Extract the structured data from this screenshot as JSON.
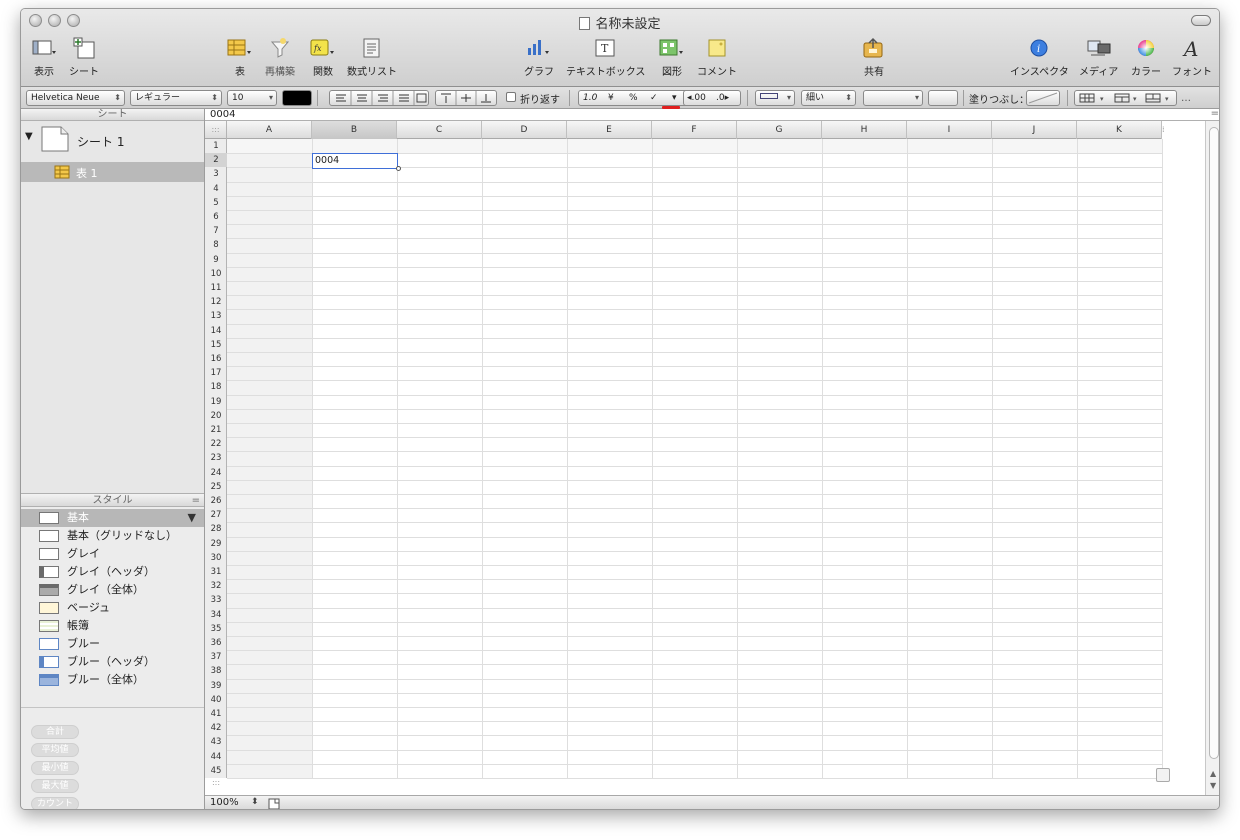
{
  "window": {
    "title": "名称未設定"
  },
  "toolbar": {
    "view": "表示",
    "sheet": "シート",
    "table": "表",
    "reorganize": "再構築",
    "function": "関数",
    "formula_list": "数式リスト",
    "chart": "グラフ",
    "textbox": "テキストボックス",
    "shape": "図形",
    "comment": "コメント",
    "share": "共有",
    "inspector": "インスペクタ",
    "media": "メディア",
    "colors": "カラー",
    "fonts": "フォント"
  },
  "formatbar": {
    "font_family": "Helvetica Neue",
    "font_style": "レギュラー",
    "font_size": "10",
    "wrap": "折り返す",
    "currency": "¥",
    "percent": "%",
    "check": "✓",
    "dec_decrease": "◂.00",
    "dec_increase": ".0▸",
    "stroke": "細い",
    "fill_label": "塗りつぶし：",
    "number_format": "1.0",
    "more": "…"
  },
  "sheets_header": "シート",
  "sheet": {
    "name": "シート 1",
    "table_name": "表 1"
  },
  "styles": {
    "header": "スタイル",
    "items": [
      "基本",
      "基本（グリッドなし）",
      "グレイ",
      "グレイ（ヘッダ）",
      "グレイ（全体）",
      "ベージュ",
      "帳簿",
      "ブルー",
      "ブルー（ヘッダ）",
      "ブルー（全体）"
    ],
    "swatch_colors": [
      "#ffffff",
      "#ffffff",
      "#ffffff",
      "#6a6a6a",
      "#8a8a8a",
      "#fff6d8",
      "#e9f1d6",
      "#ffffff",
      "#5e86c4",
      "#5e86c4"
    ]
  },
  "functions": [
    "合計",
    "平均値",
    "最小値",
    "最大値",
    "カウント"
  ],
  "formula": {
    "value": "0004"
  },
  "grid": {
    "columns": [
      "A",
      "B",
      "C",
      "D",
      "E",
      "F",
      "G",
      "H",
      "I",
      "J",
      "K"
    ],
    "rows": 45,
    "selected_cell": {
      "col": "B",
      "row": 2,
      "value": "0004"
    }
  },
  "zoom": "100%",
  "colors": {
    "selection": "#3f6fd8",
    "header_bg": "#e6e6e6",
    "grid_line": "#dedede",
    "warn_underline": "#e02020"
  }
}
